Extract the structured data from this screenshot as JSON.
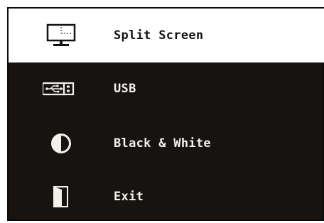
{
  "menu": {
    "items": [
      {
        "label": "Split Screen",
        "icon": "split-screen-monitor-icon",
        "selected": true
      },
      {
        "label": "USB",
        "icon": "usb-drive-icon",
        "selected": false
      },
      {
        "label": "Black & White",
        "icon": "contrast-half-circle-icon",
        "selected": false
      },
      {
        "label": "Exit",
        "icon": "exit-door-icon",
        "selected": false
      }
    ]
  },
  "colors": {
    "menu_background": "#161310",
    "selected_background": "#ffffff",
    "text_light": "#f4f1ec",
    "text_dark": "#151311"
  }
}
